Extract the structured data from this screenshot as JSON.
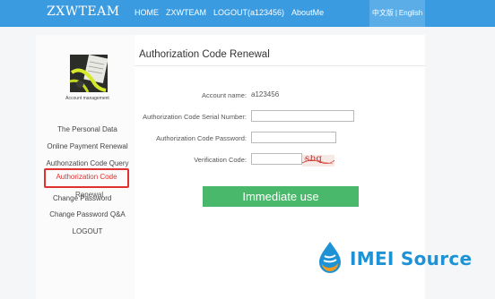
{
  "header": {
    "brand": "ZXWTEAM",
    "nav": [
      {
        "label": "HOME"
      },
      {
        "label": "ZXWTEAM"
      },
      {
        "label": "LOGOUT(a123456)"
      },
      {
        "label": "AboutMe"
      }
    ],
    "lang_cn": "中文版",
    "lang_sep": "|",
    "lang_en": "English"
  },
  "sidebar": {
    "avatar_caption": "Account management",
    "items": [
      {
        "label": "The Personal Data"
      },
      {
        "label": "Online Payment Renewal"
      },
      {
        "label": "Authonzation Code Query"
      },
      {
        "label": "Authorization Code"
      },
      {
        "label": "Change Password"
      },
      {
        "label": "Renewal"
      },
      {
        "label": "Change Password Q&A"
      },
      {
        "label": "LOGOUT"
      }
    ]
  },
  "form": {
    "title": "Authorization Code Renewal",
    "account_label": "Account name:",
    "account_value": "a123456",
    "serial_label": "Authorization Code Serial Number:",
    "serial_value": "",
    "password_label": "Authorization Code Password:",
    "password_value": "",
    "verification_label": "Verification Code:",
    "verification_value": "",
    "captcha_text": "sbq",
    "submit_label": "Immediate use"
  },
  "watermark": {
    "word1": "IMEI",
    "word2": "Source",
    "color": "#1d93d6"
  },
  "colors": {
    "topbar": "#3a9be0",
    "active_border": "#e03030",
    "submit": "#4ab86a"
  }
}
